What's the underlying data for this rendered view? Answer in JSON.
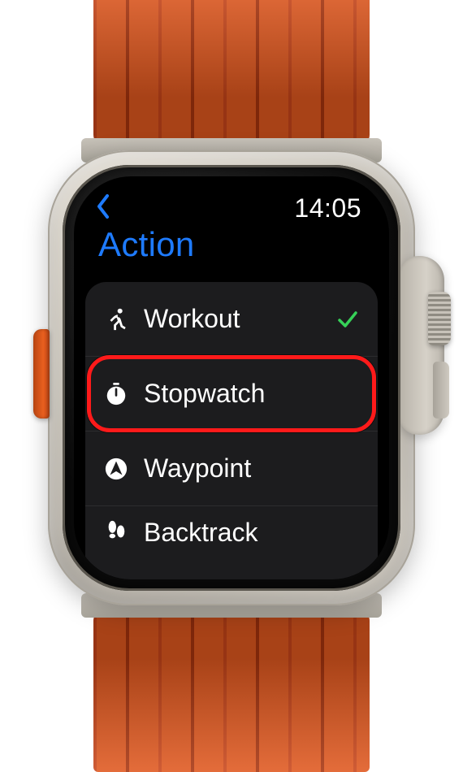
{
  "status": {
    "time": "14:05"
  },
  "header": {
    "title": "Action"
  },
  "action_list": {
    "items": [
      {
        "id": "workout",
        "label": "Workout",
        "icon": "running-icon",
        "selected": true,
        "highlighted": false
      },
      {
        "id": "stopwatch",
        "label": "Stopwatch",
        "icon": "stopwatch-icon",
        "selected": false,
        "highlighted": true
      },
      {
        "id": "waypoint",
        "label": "Waypoint",
        "icon": "location-icon",
        "selected": false,
        "highlighted": false
      },
      {
        "id": "backtrack",
        "label": "Backtrack",
        "icon": "footsteps-icon",
        "selected": false,
        "highlighted": false
      }
    ]
  },
  "colors": {
    "accent": "#1e7bff",
    "check": "#36d158",
    "highlight": "#ff1a1a",
    "band": "#e0561f"
  }
}
